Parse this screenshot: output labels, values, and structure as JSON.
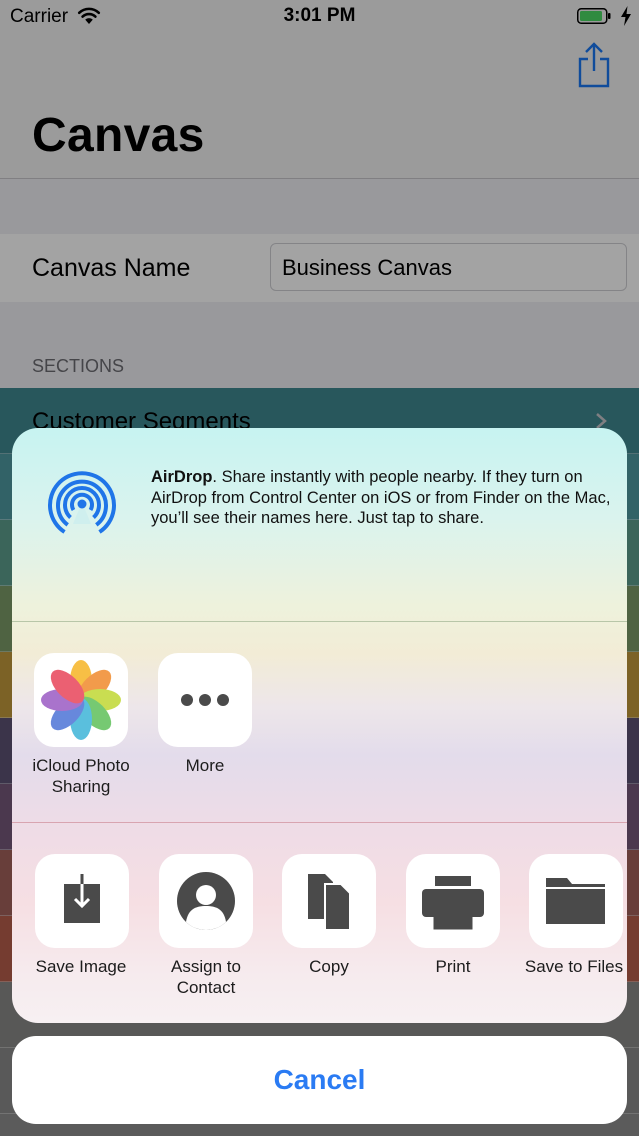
{
  "status_bar": {
    "carrier": "Carrier",
    "time": "3:01 PM",
    "battery_color": "#4cd964"
  },
  "background_app": {
    "title": "Canvas",
    "share_icon": "share-icon",
    "canvas_name_label": "Canvas Name",
    "canvas_name_value": "Business Canvas",
    "sections_header": "SECTIONS",
    "sections": [
      {
        "label": "Customer Segments",
        "color": "#3f8891"
      },
      {
        "label": "",
        "color": "#4f9aa2"
      },
      {
        "label": "",
        "color": "#5d9f8d"
      },
      {
        "label": "",
        "color": "#7c9c68"
      },
      {
        "label": "",
        "color": "#c39a3c"
      },
      {
        "label": "",
        "color": "#5d5274"
      },
      {
        "label": "",
        "color": "#76587a"
      },
      {
        "label": "",
        "color": "#a3625c"
      },
      {
        "label": "",
        "color": "#b75e4c"
      },
      {
        "label": "",
        "color": "#8a8a88"
      },
      {
        "label": "",
        "color": "#8c8c8c"
      },
      {
        "label": "",
        "color": "#8f8f8f"
      }
    ]
  },
  "share_sheet": {
    "airdrop": {
      "title": "AirDrop",
      "description": ". Share instantly with people nearby. If they turn on AirDrop from Control Center on iOS or from Finder on the Mac, you’ll see their names here. Just tap to share.",
      "icon": "airdrop-icon"
    },
    "apps": [
      {
        "label": "iCloud Photo Sharing",
        "icon": "photos-icon"
      },
      {
        "label": "More",
        "icon": "more-icon"
      }
    ],
    "actions": [
      {
        "label": "Save Image",
        "icon": "save-image-icon"
      },
      {
        "label": "Assign to Contact",
        "icon": "contact-icon"
      },
      {
        "label": "Copy",
        "icon": "copy-icon"
      },
      {
        "label": "Print",
        "icon": "print-icon"
      },
      {
        "label": "Save to Files",
        "icon": "folder-icon"
      }
    ],
    "cancel_label": "Cancel",
    "accent_color": "#2a7bf3"
  }
}
